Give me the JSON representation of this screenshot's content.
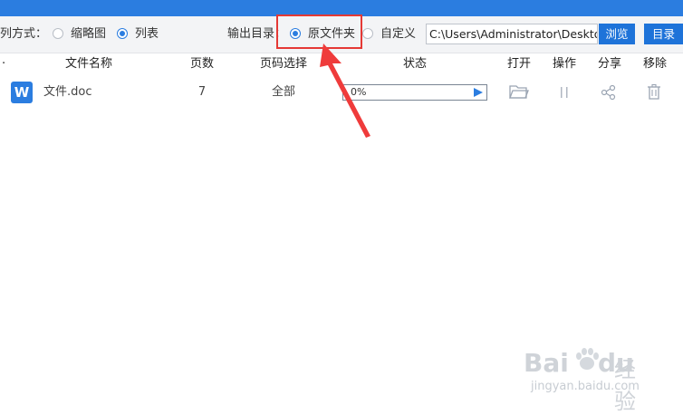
{
  "toolbar": {
    "view_mode_label": "列方式：",
    "view_options": [
      {
        "label": "缩略图",
        "selected": false
      },
      {
        "label": "列表",
        "selected": true
      }
    ],
    "output_dir_label": "输出目录：",
    "output_options": [
      {
        "label": "原文件夹",
        "selected": true
      },
      {
        "label": "自定义",
        "selected": false
      }
    ],
    "path_value": "C:\\Users\\Administrator\\Desktop",
    "browse_label": "浏览",
    "dir_label": "目录"
  },
  "table": {
    "headers": [
      "文件名称",
      "页数",
      "页码选择",
      "状态",
      "打开",
      "操作",
      "分享",
      "移除"
    ],
    "rows": [
      {
        "file_icon": "W",
        "file_name": "文件.doc",
        "pages": "7",
        "page_selection": "全部",
        "progress_text": "0%",
        "progress": 0.0
      }
    ]
  },
  "watermark": {
    "brand": "Bai",
    "brand2": "du",
    "cn": "经验",
    "url": "jingyan.baidu.com"
  },
  "colors": {
    "accent": "#2b7de0",
    "highlight": "#e53935"
  }
}
